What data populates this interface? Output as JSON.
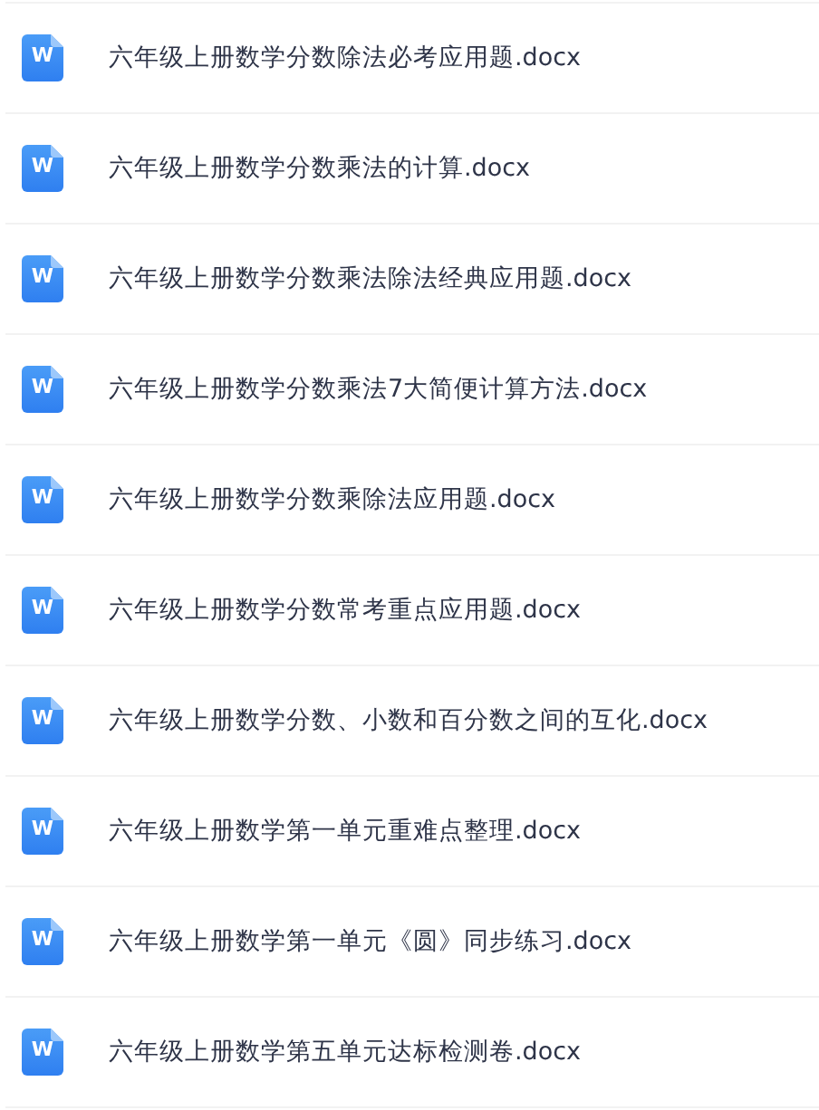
{
  "files": [
    {
      "name": "六年级上册数学分数除法必考应用题.docx",
      "icon_label": "W"
    },
    {
      "name": "六年级上册数学分数乘法的计算.docx",
      "icon_label": "W"
    },
    {
      "name": "六年级上册数学分数乘法除法经典应用题.docx",
      "icon_label": "W"
    },
    {
      "name": "六年级上册数学分数乘法7大简便计算方法.docx",
      "icon_label": "W"
    },
    {
      "name": "六年级上册数学分数乘除法应用题.docx",
      "icon_label": "W"
    },
    {
      "name": "六年级上册数学分数常考重点应用题.docx",
      "icon_label": "W"
    },
    {
      "name": "六年级上册数学分数、小数和百分数之间的互化.docx",
      "icon_label": "W"
    },
    {
      "name": "六年级上册数学第一单元重难点整理.docx",
      "icon_label": "W"
    },
    {
      "name": "六年级上册数学第一单元《圆》同步练习.docx",
      "icon_label": "W"
    },
    {
      "name": "六年级上册数学第五单元达标检测卷.docx",
      "icon_label": "W"
    }
  ]
}
